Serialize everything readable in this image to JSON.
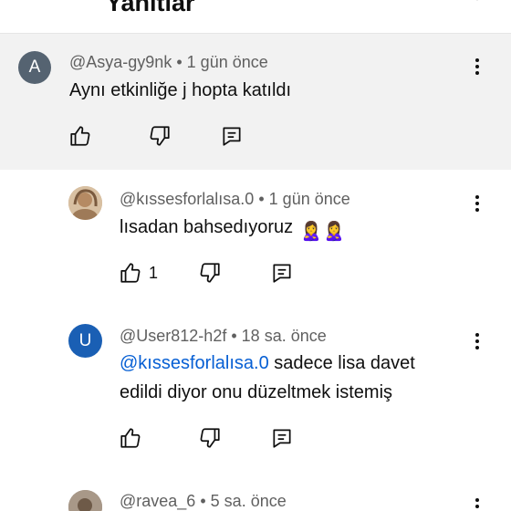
{
  "header": {
    "title": "Yanıtlar"
  },
  "comments": [
    {
      "author": "@Asya-gy9nk",
      "time": "1 gün önce",
      "avatar_letter": "A",
      "avatar_color": "#556371",
      "text": "Aynı etkinliğe j hopta katıldı",
      "like_count": ""
    },
    {
      "author": "@kıssesforlalısa.0",
      "time": "1 gün önce",
      "avatar_color": "#c9a47d",
      "text": "lısadan bahsedıyoruz",
      "emoji": "🙎‍♀️🙎‍♀️",
      "like_count": "1"
    },
    {
      "author": "@User812-h2f",
      "time": "18 sa. önce",
      "avatar_letter": "U",
      "avatar_color": "#1a5fb4",
      "mention": "@kıssesforlalısa.0",
      "text": " sadece lisa davet",
      "text_line2": "edildi diyor onu düzeltmek istemiş",
      "like_count": ""
    },
    {
      "author": "@ravea_6",
      "time": "5 sa. önce",
      "avatar_color": "#8a7a6a"
    }
  ],
  "separator": "•"
}
